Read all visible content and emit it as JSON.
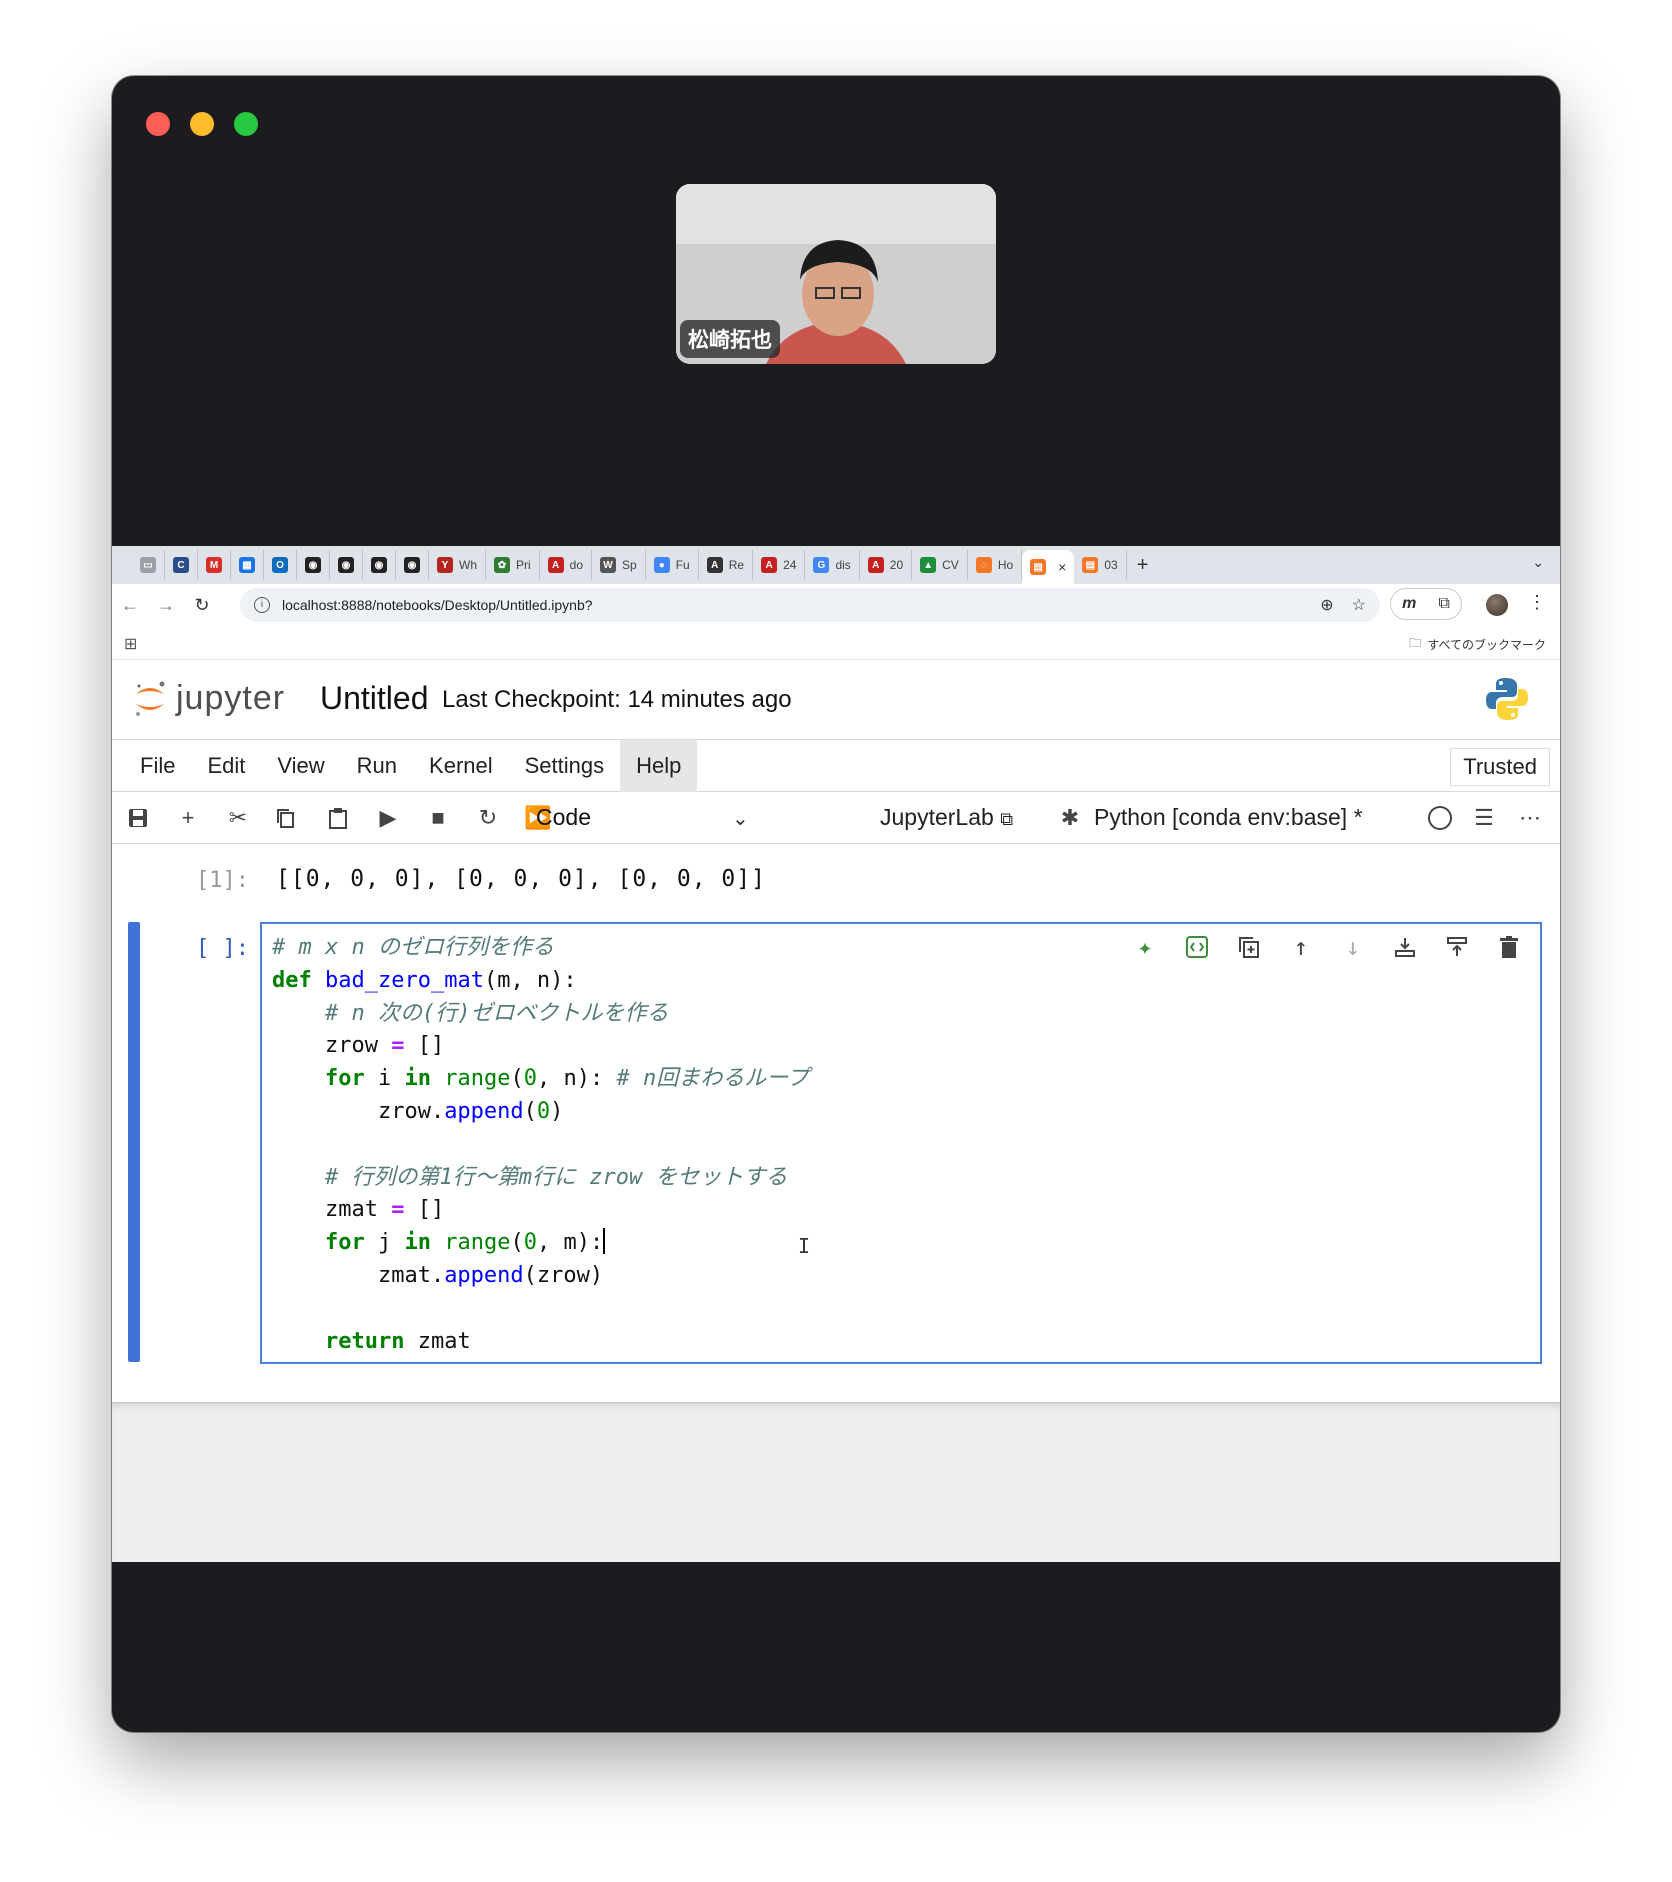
{
  "video": {
    "participant_name": "松崎拓也"
  },
  "browser": {
    "tabs": [
      {
        "label": "",
        "icon": "sidebar-tab-icon",
        "color": "#9aa0a6"
      },
      {
        "label": "",
        "icon": "c-app-icon",
        "color": "#2c4b8a"
      },
      {
        "label": "",
        "icon": "gmail-icon",
        "color": "#d93025"
      },
      {
        "label": "",
        "icon": "calendar-icon",
        "color": "#1a73e8"
      },
      {
        "label": "",
        "icon": "outlook-icon",
        "color": "#0f6cbd"
      },
      {
        "label": "",
        "icon": "github-icon",
        "color": "#222222"
      },
      {
        "label": "",
        "icon": "github-icon",
        "color": "#222222"
      },
      {
        "label": "",
        "icon": "github-icon",
        "color": "#222222"
      },
      {
        "label": "",
        "icon": "github-icon",
        "color": "#222222"
      },
      {
        "label": "Wh",
        "icon": "wine-icon",
        "color": "#b3261e"
      },
      {
        "label": "Pri",
        "icon": "plant-icon",
        "color": "#2e7d32"
      },
      {
        "label": "do",
        "icon": "pdf-icon",
        "color": "#c5221f"
      },
      {
        "label": "Sp",
        "icon": "wikipedia-icon",
        "color": "#555555"
      },
      {
        "label": "Fu",
        "icon": "circle-app-icon",
        "color": "#4285f4"
      },
      {
        "label": "Re",
        "icon": "a-app-icon",
        "color": "#333333"
      },
      {
        "label": "24",
        "icon": "pdf-icon",
        "color": "#c5221f"
      },
      {
        "label": "dis",
        "icon": "google-icon",
        "color": "#4285f4"
      },
      {
        "label": "20",
        "icon": "pdf-icon",
        "color": "#c5221f"
      },
      {
        "label": "CV",
        "icon": "drive-icon",
        "color": "#1e8e3e"
      },
      {
        "label": "Ho",
        "icon": "jupyter-tab-icon",
        "color": "#f37726"
      },
      {
        "label": "",
        "icon": "notebook-tab-icon",
        "color": "#f37726",
        "active": true
      },
      {
        "label": "03",
        "icon": "notebook-tab-icon",
        "color": "#f37726"
      }
    ],
    "url": "localhost:8888/notebooks/Desktop/Untitled.ipynb?",
    "bookmarks_all": "すべてのブックマーク"
  },
  "jupyter": {
    "logo_text": "jupyter",
    "title": "Untitled",
    "checkpoint": "Last Checkpoint: 14 minutes ago",
    "menu": [
      "File",
      "Edit",
      "View",
      "Run",
      "Kernel",
      "Settings",
      "Help"
    ],
    "trusted": "Trusted",
    "cell_type": "Code",
    "jupyterlab_link": "JupyterLab",
    "kernel": "Python [conda env:base] *",
    "output_prompt": "[1]:",
    "output_text": "[[0, 0, 0], [0, 0, 0], [0, 0, 0]]",
    "input_prompt": "[ ]:"
  },
  "code_lines": [
    "# m x n のゼロ行列を作る",
    "def bad_zero_mat(m, n):",
    "    # n 次の(行)ゼロベクトルを作る",
    "    zrow = []",
    "    for i in range(0, n): # n回まわるループ",
    "        zrow.append(0)",
    "",
    "    # 行列の第1行〜第m行に zrow をセットする",
    "    zmat = []",
    "    for j in range(0, m):",
    "        zmat.append(zrow)",
    "",
    "    return zmat"
  ],
  "colors": {
    "accent_blue": "#3f73d9",
    "jupyter_orange": "#f37726",
    "python_blue": "#3776ab",
    "python_yellow": "#ffd43b"
  }
}
